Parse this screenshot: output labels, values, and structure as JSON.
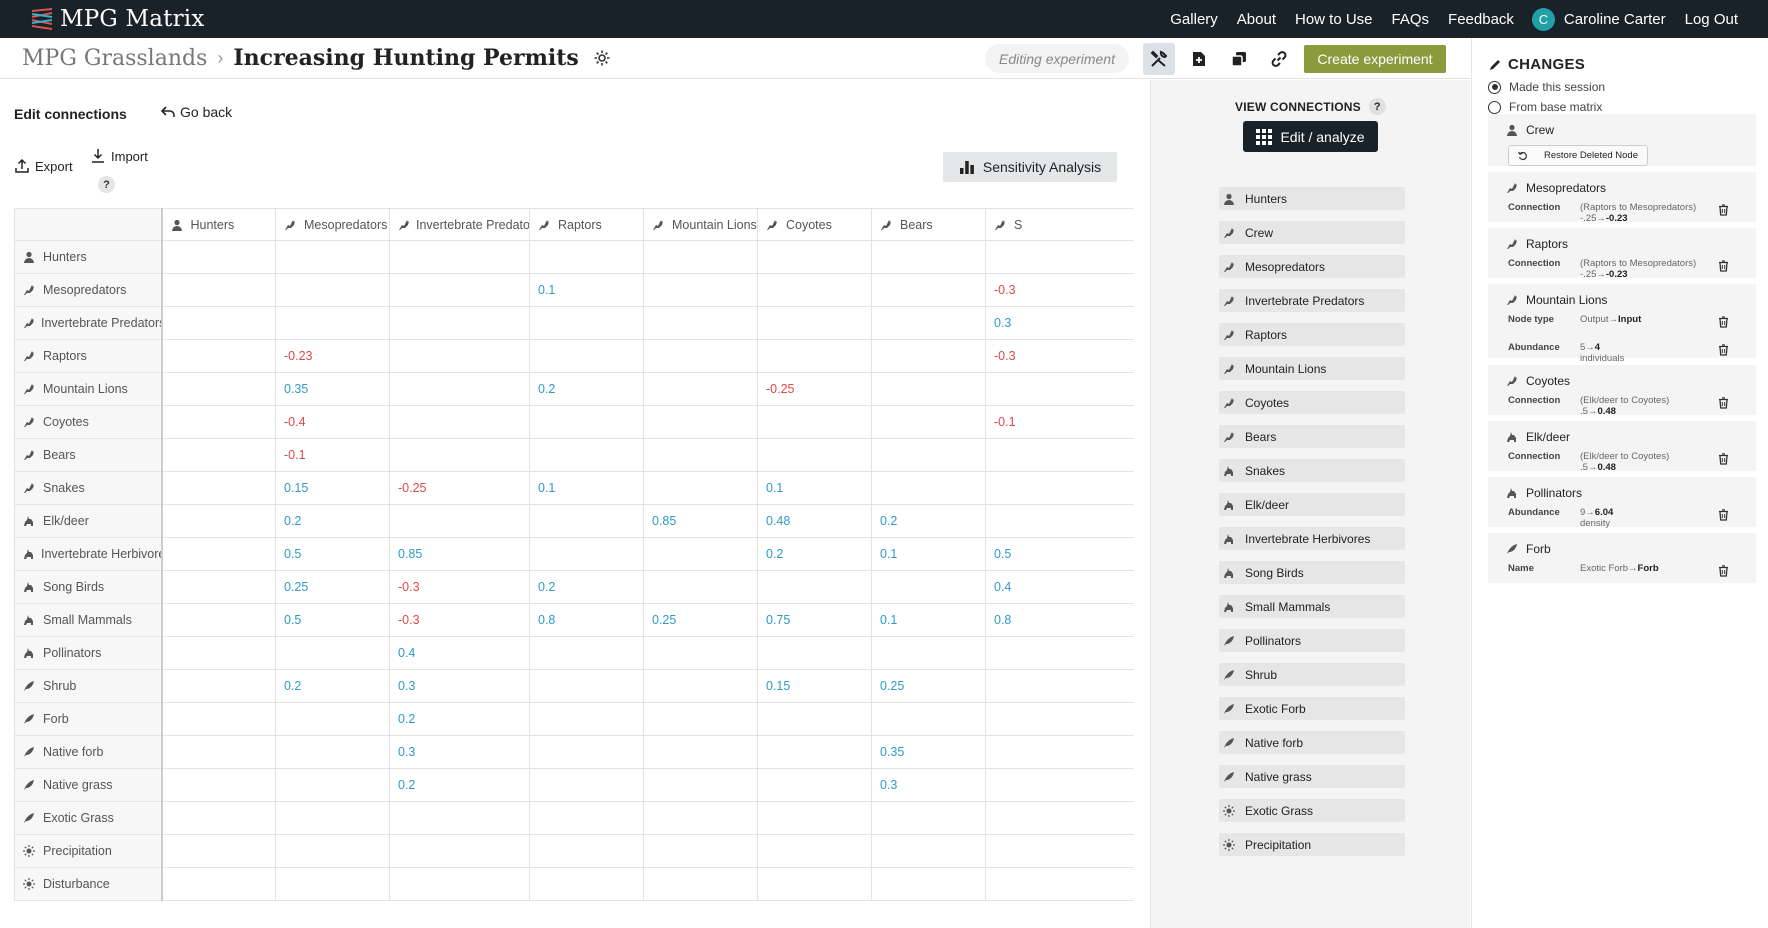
{
  "app": {
    "title": "MPG Matrix"
  },
  "nav": {
    "items": [
      "Gallery",
      "About",
      "How to Use",
      "FAQs",
      "Feedback"
    ],
    "avatar_letter": "C",
    "user": "Caroline Carter",
    "logout": "Log Out"
  },
  "breadcrumb": {
    "parent": "MPG Grasslands",
    "sep": "›",
    "current": "Increasing Hunting Permits"
  },
  "toolbar": {
    "editing": "Editing experiment",
    "create": "Create experiment"
  },
  "editor": {
    "title": "Edit connections",
    "go_back": "Go back",
    "export": "Export",
    "import": "Import",
    "help": "?",
    "sensitivity": "Sensitivity Analysis"
  },
  "grid": {
    "columns": [
      {
        "label": "Hunters",
        "icon": "person"
      },
      {
        "label": "Mesopredators",
        "icon": "predator"
      },
      {
        "label": "Invertebrate Predators",
        "icon": "predator"
      },
      {
        "label": "Raptors",
        "icon": "predator"
      },
      {
        "label": "Mountain Lions",
        "icon": "predator"
      },
      {
        "label": "Coyotes",
        "icon": "predator"
      },
      {
        "label": "Bears",
        "icon": "predator"
      },
      {
        "label": "S",
        "icon": "predator"
      }
    ],
    "rows": [
      {
        "label": "Hunters",
        "icon": "person",
        "cells": [
          "",
          "",
          "",
          "",
          "",
          "",
          "",
          ""
        ]
      },
      {
        "label": "Mesopredators",
        "icon": "predator",
        "cells": [
          "",
          "",
          "",
          "0.1",
          "",
          "",
          "",
          "-0.3"
        ]
      },
      {
        "label": "Invertebrate Predators",
        "icon": "predator",
        "cells": [
          "",
          "",
          "",
          "",
          "",
          "",
          "",
          "0.3"
        ]
      },
      {
        "label": "Raptors",
        "icon": "predator",
        "cells": [
          "",
          "-0.23",
          "",
          "",
          "",
          "",
          "",
          "-0.3"
        ]
      },
      {
        "label": "Mountain Lions",
        "icon": "predator",
        "cells": [
          "",
          "0.35",
          "",
          "0.2",
          "",
          "-0.25",
          "",
          ""
        ]
      },
      {
        "label": "Coyotes",
        "icon": "predator",
        "cells": [
          "",
          "-0.4",
          "",
          "",
          "",
          "",
          "",
          "-0.1"
        ]
      },
      {
        "label": "Bears",
        "icon": "predator",
        "cells": [
          "",
          "-0.1",
          "",
          "",
          "",
          "",
          "",
          ""
        ]
      },
      {
        "label": "Snakes",
        "icon": "predator",
        "cells": [
          "",
          "0.15",
          "-0.25",
          "0.1",
          "",
          "0.1",
          "",
          ""
        ]
      },
      {
        "label": "Elk/deer",
        "icon": "herbivore",
        "cells": [
          "",
          "0.2",
          "",
          "",
          "0.85",
          "0.48",
          "0.2",
          ""
        ]
      },
      {
        "label": "Invertebrate Herbivores",
        "icon": "herbivore",
        "cells": [
          "",
          "0.5",
          "0.85",
          "",
          "",
          "0.2",
          "0.1",
          "0.5"
        ]
      },
      {
        "label": "Song Birds",
        "icon": "herbivore",
        "cells": [
          "",
          "0.25",
          "-0.3",
          "0.2",
          "",
          "",
          "",
          "0.4"
        ]
      },
      {
        "label": "Small Mammals",
        "icon": "herbivore",
        "cells": [
          "",
          "0.5",
          "-0.3",
          "0.8",
          "0.25",
          "0.75",
          "0.1",
          "0.8"
        ]
      },
      {
        "label": "Pollinators",
        "icon": "herbivore",
        "cells": [
          "",
          "",
          "0.4",
          "",
          "",
          "",
          "",
          ""
        ]
      },
      {
        "label": "Shrub",
        "icon": "plant",
        "cells": [
          "",
          "0.2",
          "0.3",
          "",
          "",
          "0.15",
          "0.25",
          ""
        ]
      },
      {
        "label": "Forb",
        "icon": "plant",
        "cells": [
          "",
          "",
          "0.2",
          "",
          "",
          "",
          "",
          ""
        ]
      },
      {
        "label": "Native forb",
        "icon": "plant",
        "cells": [
          "",
          "",
          "0.3",
          "",
          "",
          "",
          "0.35",
          ""
        ]
      },
      {
        "label": "Native grass",
        "icon": "plant",
        "cells": [
          "",
          "",
          "0.2",
          "",
          "",
          "",
          "0.3",
          ""
        ]
      },
      {
        "label": "Exotic Grass",
        "icon": "plant",
        "cells": [
          "",
          "",
          "",
          "",
          "",
          "",
          "",
          ""
        ]
      },
      {
        "label": "Precipitation",
        "icon": "sun",
        "cells": [
          "",
          "",
          "",
          "",
          "",
          "",
          "",
          ""
        ]
      },
      {
        "label": "Disturbance",
        "icon": "sun",
        "cells": [
          "",
          "",
          "",
          "",
          "",
          "",
          "",
          ""
        ]
      }
    ]
  },
  "view_connections": {
    "title": "VIEW CONNECTIONS",
    "help": "?",
    "button": "Edit / analyze",
    "nodes": [
      {
        "label": "Hunters",
        "icon": "person"
      },
      {
        "label": "Crew",
        "icon": "predator"
      },
      {
        "label": "Mesopredators",
        "icon": "predator"
      },
      {
        "label": "Invertebrate Predators",
        "icon": "predator"
      },
      {
        "label": "Raptors",
        "icon": "predator"
      },
      {
        "label": "Mountain Lions",
        "icon": "predator"
      },
      {
        "label": "Coyotes",
        "icon": "predator"
      },
      {
        "label": "Bears",
        "icon": "predator"
      },
      {
        "label": "Snakes",
        "icon": "herbivore"
      },
      {
        "label": "Elk/deer",
        "icon": "herbivore"
      },
      {
        "label": "Invertebrate Herbivores",
        "icon": "herbivore"
      },
      {
        "label": "Song Birds",
        "icon": "herbivore"
      },
      {
        "label": "Small Mammals",
        "icon": "herbivore"
      },
      {
        "label": "Pollinators",
        "icon": "plant"
      },
      {
        "label": "Shrub",
        "icon": "plant"
      },
      {
        "label": "Exotic Forb",
        "icon": "plant"
      },
      {
        "label": "Native forb",
        "icon": "plant"
      },
      {
        "label": "Native grass",
        "icon": "plant"
      },
      {
        "label": "Exotic Grass",
        "icon": "sun"
      },
      {
        "label": "Precipitation",
        "icon": "sun"
      }
    ]
  },
  "changes": {
    "title": "CHANGES",
    "radio_session": "Made this session",
    "radio_base": "From base matrix",
    "cards": [
      {
        "name": "Crew",
        "icon": "person",
        "restore": "Restore Deleted Node",
        "rows": []
      },
      {
        "name": "Mesopredators",
        "icon": "predator",
        "rows": [
          {
            "k": "Connection",
            "v1": "(Raptors to Mesopredators)",
            "v2": "-.25→",
            "v3": "-0.23"
          }
        ]
      },
      {
        "name": "Raptors",
        "icon": "predator",
        "rows": [
          {
            "k": "Connection",
            "v1": "(Raptors to Mesopredators)",
            "v2": "-.25→",
            "v3": "-0.23"
          }
        ]
      },
      {
        "name": "Mountain Lions",
        "icon": "predator",
        "rows": [
          {
            "k": "Node type",
            "v1": "",
            "v2": "Output→",
            "v3": "Input"
          },
          {
            "k": "Abundance",
            "v1": "",
            "v2": "5→",
            "v3": "4",
            "v4": "individuals"
          }
        ]
      },
      {
        "name": "Coyotes",
        "icon": "predator",
        "rows": [
          {
            "k": "Connection",
            "v1": "(Elk/deer to Coyotes)",
            "v2": ".5→",
            "v3": "0.48"
          }
        ]
      },
      {
        "name": "Elk/deer",
        "icon": "herbivore",
        "rows": [
          {
            "k": "Connection",
            "v1": "(Elk/deer to Coyotes)",
            "v2": ".5→",
            "v3": "0.48"
          }
        ]
      },
      {
        "name": "Pollinators",
        "icon": "herbivore",
        "rows": [
          {
            "k": "Abundance",
            "v1": "",
            "v2": "9→",
            "v3": "6.04",
            "v4": "density"
          }
        ]
      },
      {
        "name": "Forb",
        "icon": "plant",
        "rows": [
          {
            "k": "Name",
            "v1": "",
            "v2": "Exotic Forb→",
            "v3": "Forb"
          }
        ]
      }
    ]
  },
  "colors": {
    "topbar": "#192129",
    "accent": "#8a9a3d",
    "positive": "#2e9bc9",
    "negative": "#e04848",
    "avatar": "#22a0a8"
  }
}
